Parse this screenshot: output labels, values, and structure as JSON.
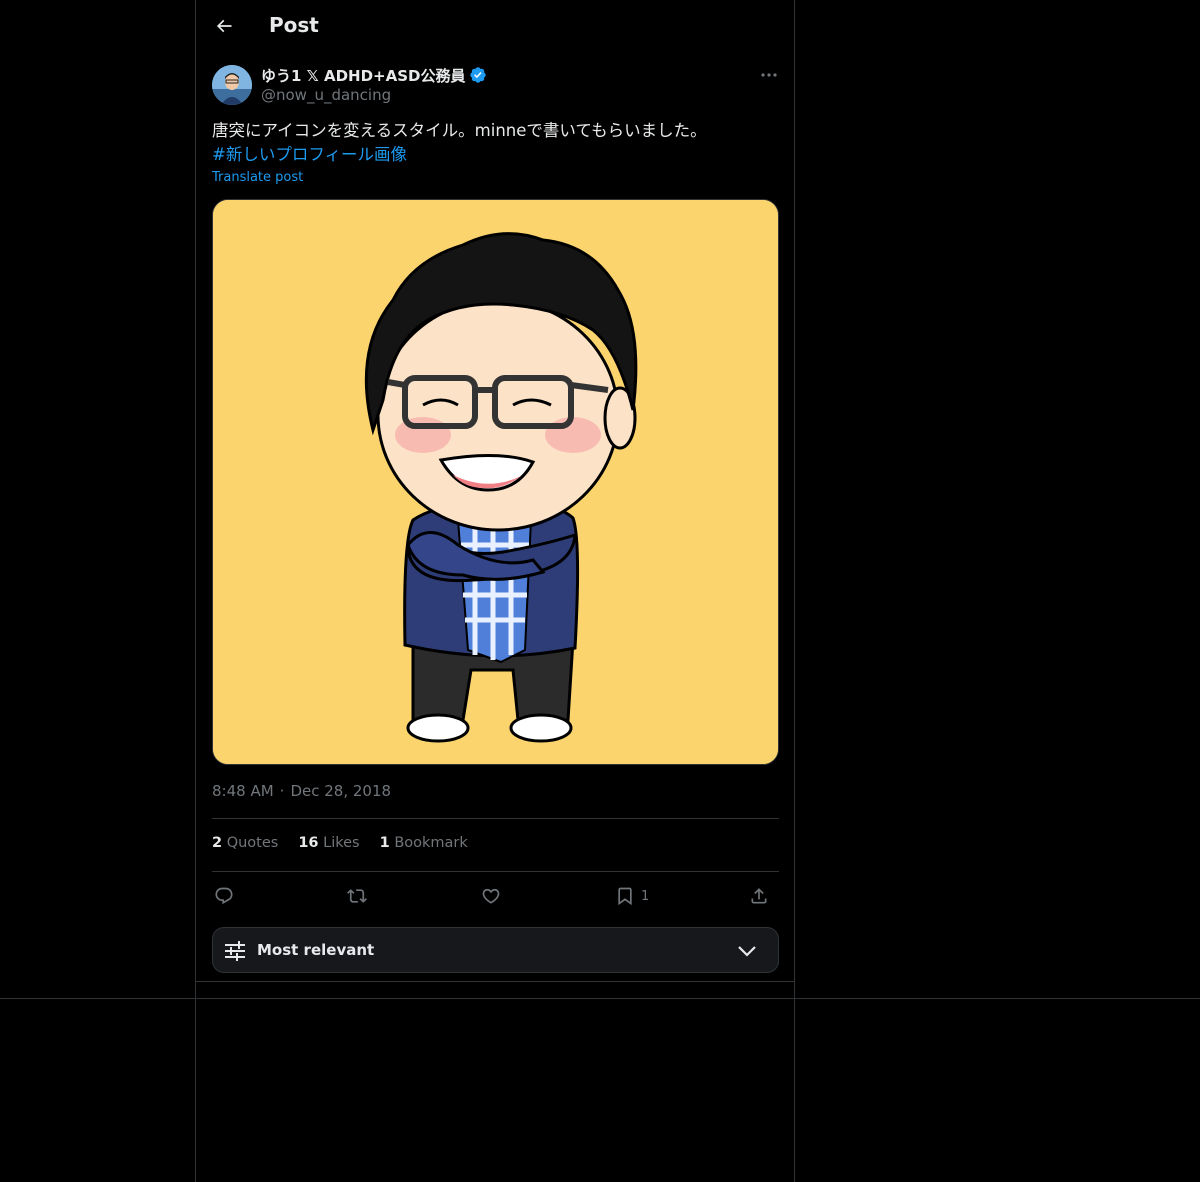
{
  "header": {
    "title": "Post",
    "back_icon": "arrow-left-icon"
  },
  "author": {
    "display_name": "ゆう1 𝕏 ADHD+ASD公務員",
    "handle": "@now_u_dancing",
    "verified": true,
    "verified_color": "#1d9bf0"
  },
  "post": {
    "text_line1": "唐突にアイコンを変えるスタイル。minneで書いてもらいました。",
    "hashtag": "#新しいプロフィール画像",
    "translate_label": "Translate post",
    "image_background": "#fcd46e",
    "time": "8:48 AM",
    "separator": "·",
    "date": "Dec 28, 2018"
  },
  "stats": {
    "quotes_count": "2",
    "quotes_label": "Quotes",
    "likes_count": "16",
    "likes_label": "Likes",
    "bookmarks_count": "1",
    "bookmarks_label": "Bookmark"
  },
  "actions": {
    "reply_icon": "reply-icon",
    "repost_icon": "repost-icon",
    "like_icon": "heart-icon",
    "bookmark_icon": "bookmark-icon",
    "bookmark_count": "1",
    "share_icon": "share-icon"
  },
  "replies_sort": {
    "label": "Most relevant",
    "icon": "sliders-icon",
    "chevron": "chevron-down-icon"
  },
  "colors": {
    "background": "#000000",
    "border": "#2f3336",
    "link": "#1d9bf0",
    "muted": "#71767b",
    "text": "#e7e9ea"
  }
}
